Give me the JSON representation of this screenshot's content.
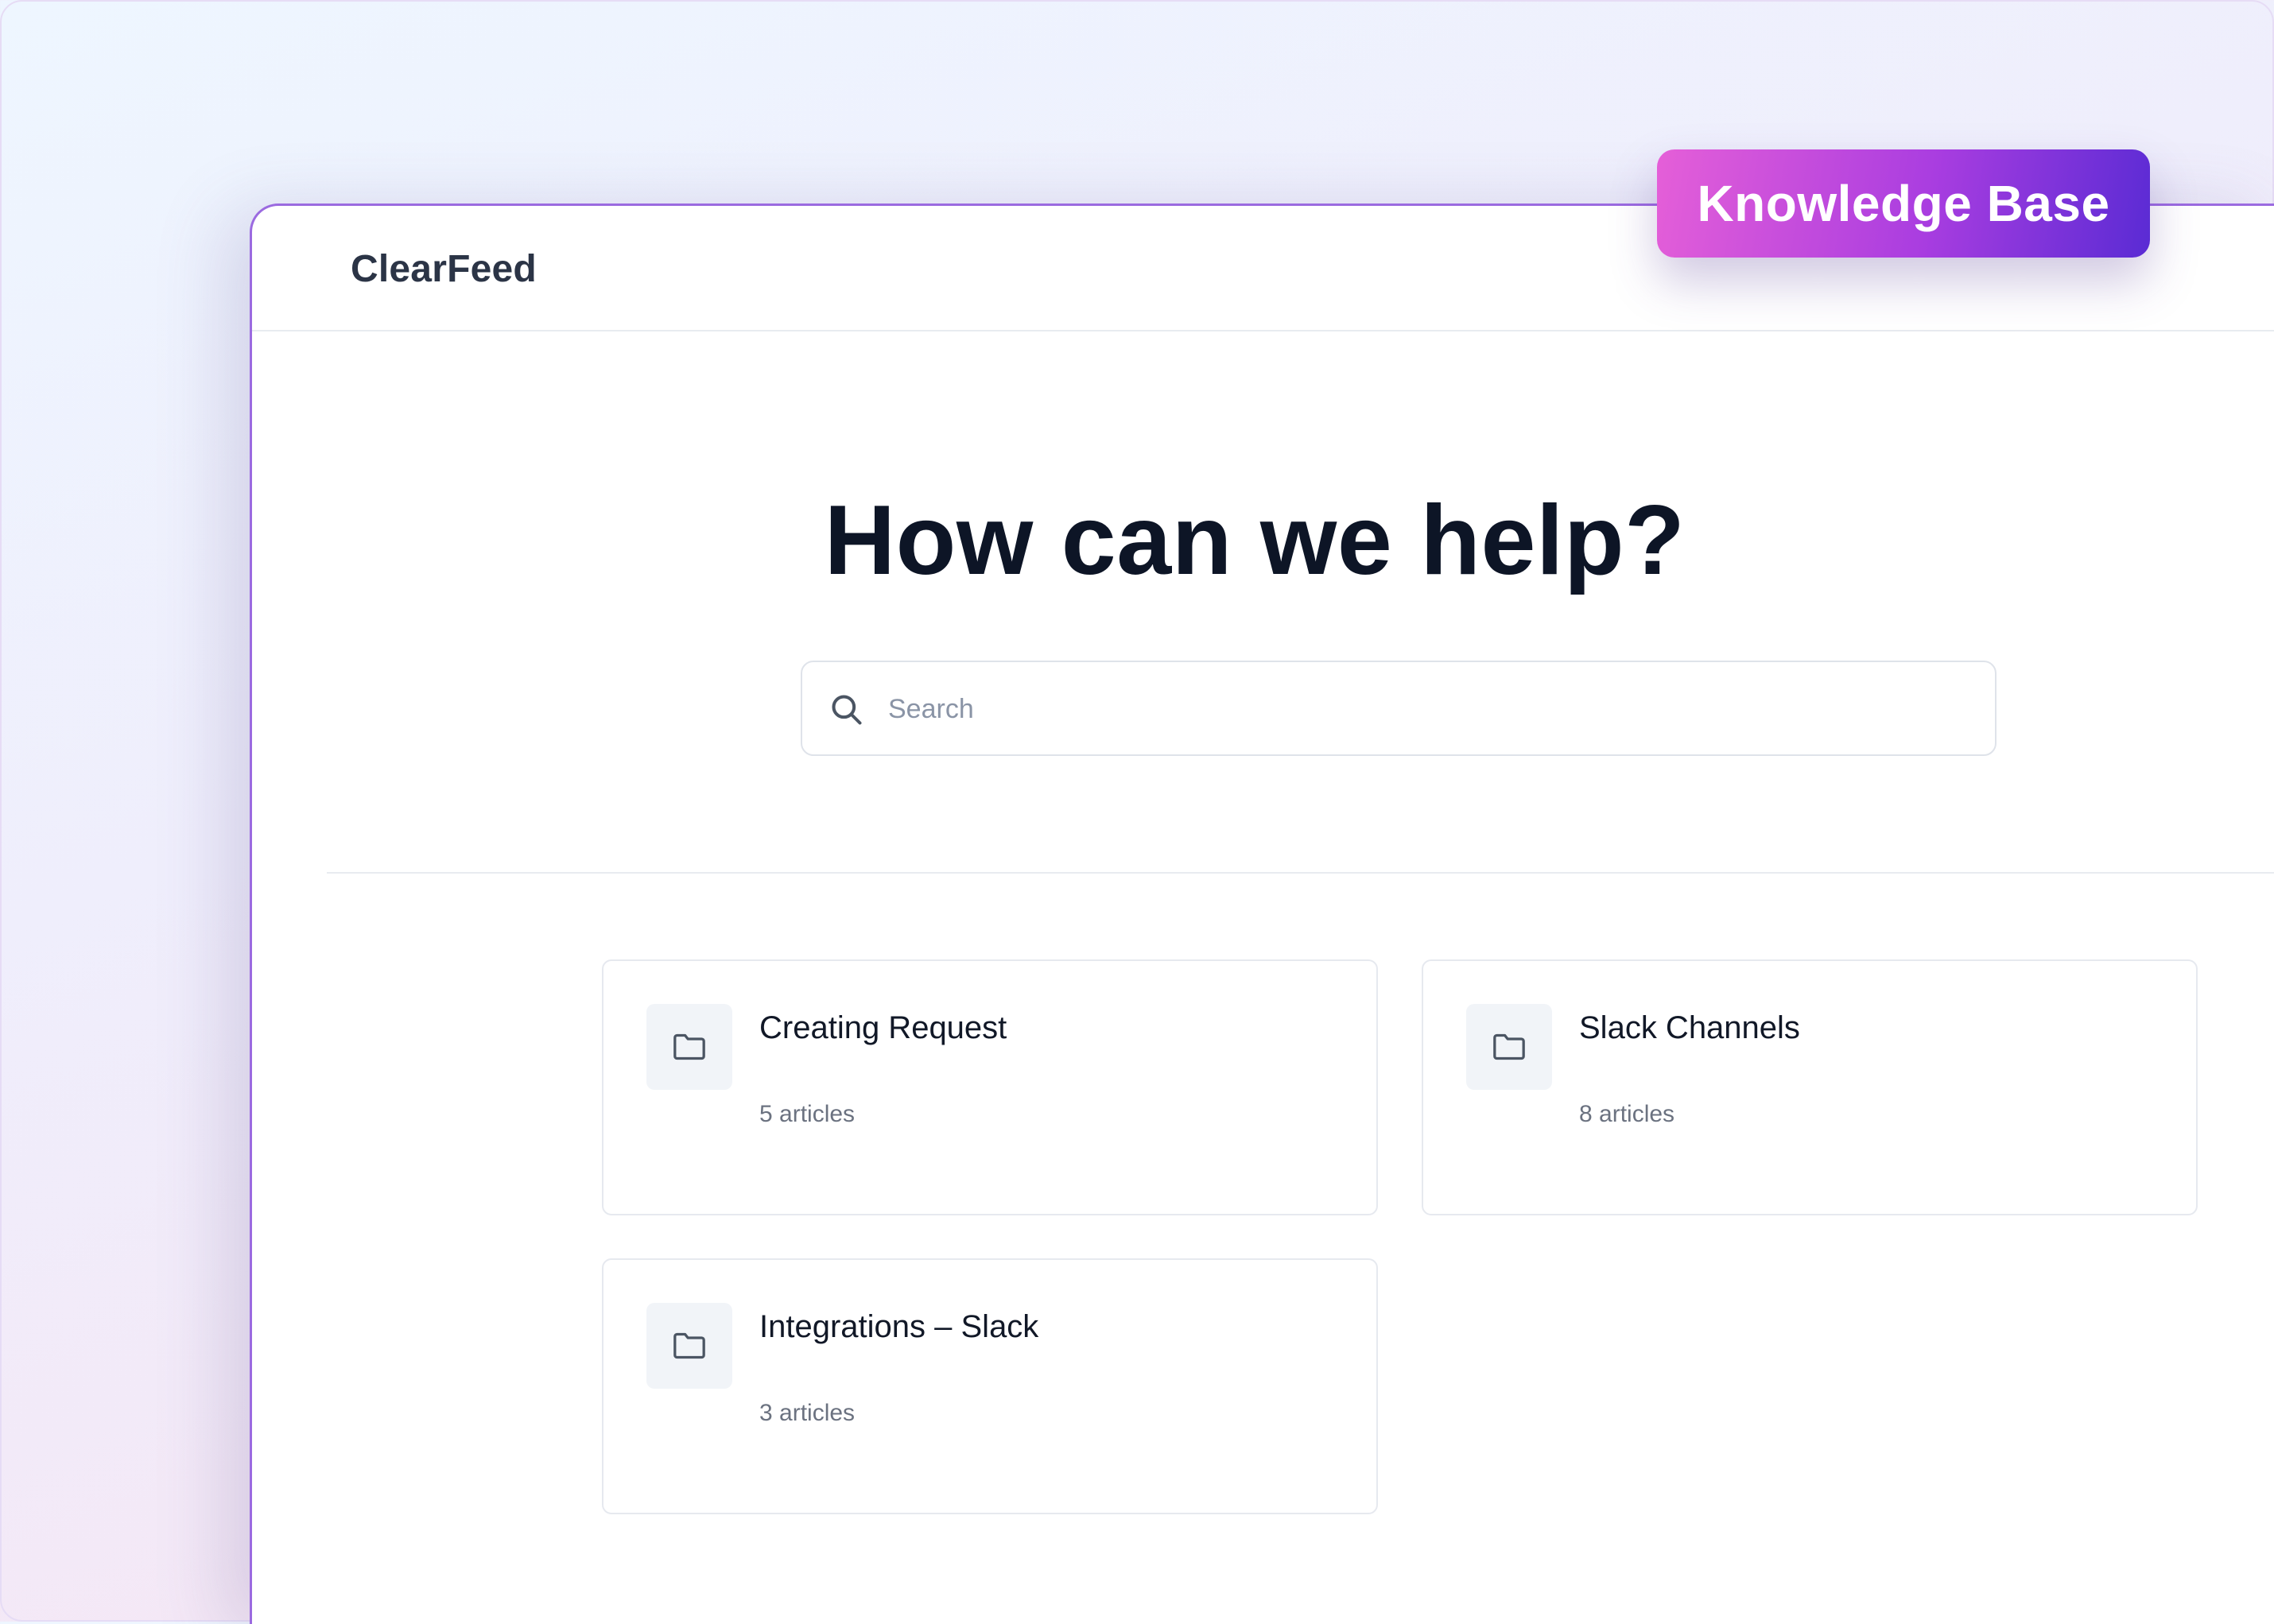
{
  "header": {
    "brand": "ClearFeed"
  },
  "badge": {
    "label": "Knowledge Base"
  },
  "hero": {
    "title": "How can we help?"
  },
  "search": {
    "placeholder": "Search",
    "value": ""
  },
  "categories": [
    {
      "title": "Creating Request",
      "count": "5 articles",
      "icon": "folder-icon"
    },
    {
      "title": "Slack Channels",
      "count": "8 articles",
      "icon": "folder-icon"
    },
    {
      "title": "Integrations – Slack",
      "count": "3 articles",
      "icon": "folder-icon"
    }
  ],
  "colors": {
    "window_border": "#9b6ae0",
    "badge_gradient_start": "#e55fd8",
    "badge_gradient_end": "#5a2bd4",
    "title_text": "#0d1526",
    "muted_text": "#6b7280"
  }
}
